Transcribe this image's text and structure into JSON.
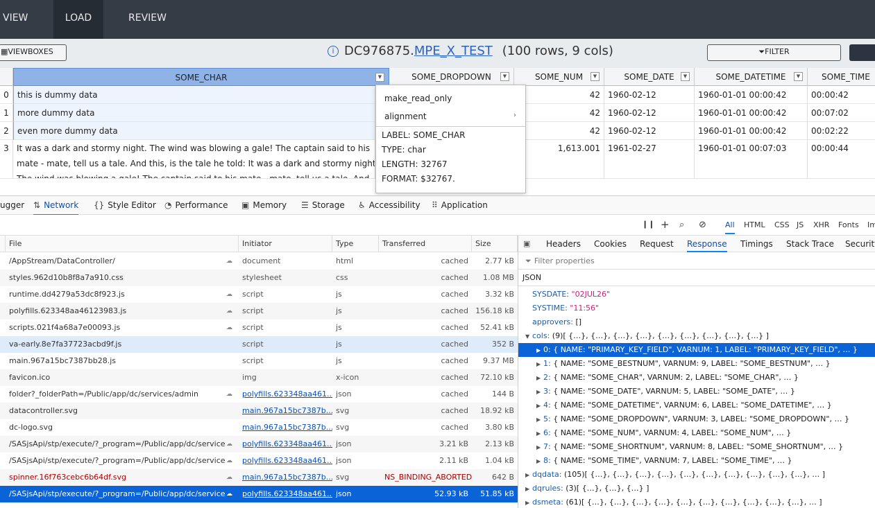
{
  "nav": {
    "tabs": [
      "VIEW",
      "LOAD",
      "REVIEW"
    ]
  },
  "titlebar": {
    "viewboxes_label": "VIEWBOXES",
    "library": "DC976875.",
    "table": "MPE_X_TEST",
    "meta": "(100 rows, 9 cols)",
    "filter_label": "FILTER"
  },
  "grid": {
    "columns": [
      "SOME_CHAR",
      "SOME_DROPDOWN",
      "SOME_NUM",
      "SOME_DATE",
      "SOME_DATETIME",
      "SOME_TIME"
    ],
    "rows": [
      {
        "idx": "0",
        "char": "this is dummy data",
        "num": "42",
        "date": "1960-02-12",
        "datetime": "1960-01-01 00:00:42",
        "time": "00:00:42"
      },
      {
        "idx": "1",
        "char": "more dummy data",
        "num": "42",
        "date": "1960-02-12",
        "datetime": "1960-01-01 00:00:42",
        "time": "00:07:02"
      },
      {
        "idx": "2",
        "char": "even more dummy data",
        "num": "42",
        "date": "1960-02-12",
        "datetime": "1960-01-01 00:00:42",
        "time": "00:02:22"
      },
      {
        "idx": "3",
        "char_lines": [
          "It was a dark and stormy night.  The wind was blowing a gale!  The captain said to his",
          "mate - mate, tell us a tale.  And this, is the tale he told: It was a dark and stormy night.",
          "The wind was blowing a gale!  The captain said to his mate - mate, tell us a tale.  And"
        ],
        "num": "1,613.001",
        "date": "1961-02-27",
        "datetime": "1960-01-01 00:07:03",
        "time": "00:00:44"
      }
    ]
  },
  "menu": {
    "items": [
      "make_read_only",
      "alignment"
    ],
    "info": [
      "LABEL: SOME_CHAR",
      "TYPE: char",
      "LENGTH: 32767",
      "FORMAT: $32767."
    ]
  },
  "devtools": {
    "tabs": [
      "ugger",
      "Network",
      "Style Editor",
      "Performance",
      "Memory",
      "Storage",
      "Accessibility",
      "Application"
    ],
    "filters": [
      "All",
      "HTML",
      "CSS",
      "JS",
      "XHR",
      "Fonts",
      "Im"
    ],
    "columns": [
      "File",
      "Initiator",
      "Type",
      "Transferred",
      "Size"
    ],
    "requests": [
      {
        "file": "/AppStream/DataController/",
        "initiator": "document",
        "type": "html",
        "transferred": "cached",
        "size": "2.77 kB"
      },
      {
        "file": "styles.962d10b8f8a7a910.css",
        "initiator": "stylesheet",
        "type": "css",
        "transferred": "cached",
        "size": "1.08 MB"
      },
      {
        "file": "runtime.dd4279a53dc8f923.js",
        "initiator": "script",
        "type": "js",
        "transferred": "cached",
        "size": "3.32 kB"
      },
      {
        "file": "polyfills.623348aa46123983.js",
        "initiator": "script",
        "type": "js",
        "transferred": "cached",
        "size": "156.18 kB"
      },
      {
        "file": "scripts.021f4a68a7e00093.js",
        "initiator": "script",
        "type": "js",
        "transferred": "cached",
        "size": "52.41 kB"
      },
      {
        "file": "va-early.8e7fa37723acbd9f.js",
        "initiator": "script",
        "type": "js",
        "transferred": "cached",
        "size": "352 B"
      },
      {
        "file": "main.967a15bc7387bb28.js",
        "initiator": "script",
        "type": "js",
        "transferred": "cached",
        "size": "9.37 MB"
      },
      {
        "file": "favicon.ico",
        "initiator": "img",
        "type": "x-icon",
        "transferred": "cached",
        "size": "72.10 kB"
      },
      {
        "file": "folder?_folderPath=/Public/app/dc/services/admin",
        "initiator": "polyfills.623348aa461...",
        "type": "json",
        "transferred": "cached",
        "size": "144 B"
      },
      {
        "file": "datacontroller.svg",
        "initiator": "main.967a15bc7387b...",
        "type": "svg",
        "transferred": "cached",
        "size": "18.92 kB"
      },
      {
        "file": "dc-logo.svg",
        "initiator": "main.967a15bc7387b...",
        "type": "svg",
        "transferred": "cached",
        "size": "3.80 kB"
      },
      {
        "file": "/SASjsApi/stp/execute/?_program=/Public/app/dc/services/p",
        "initiator": "polyfills.623348aa461...",
        "type": "json",
        "transferred": "3.21 kB",
        "size": "2.13 kB"
      },
      {
        "file": "/SASjsApi/stp/execute/?_program=/Public/app/dc/services/p",
        "initiator": "polyfills.623348aa461...",
        "type": "json",
        "transferred": "2.11 kB",
        "size": "1.04 kB"
      },
      {
        "file": "spinner.16f763cebc6b64df.svg",
        "initiator": "main.967a15bc7387b...",
        "type": "svg",
        "transferred": "NS_BINDING_ABORTED",
        "size": "642 B"
      },
      {
        "file": "/SASjsApi/stp/execute/?_program=/Public/app/dc/services/e",
        "initiator": "polyfills.623348aa461...",
        "type": "json",
        "transferred": "52.93 kB",
        "size": "51.85 kB"
      }
    ],
    "detail_tabs": [
      "Headers",
      "Cookies",
      "Request",
      "Response",
      "Timings",
      "Stack Trace",
      "Security"
    ],
    "filter_placeholder": "Filter properties",
    "json_label": "JSON",
    "json_lines": [
      {
        "key": "SYSDATE: ",
        "val": "\"02JUL26\"",
        "indent": 20,
        "tw": ""
      },
      {
        "key": "SYSTIME: ",
        "val": "\"11:56\"",
        "indent": 20,
        "tw": ""
      },
      {
        "key": "approvers: ",
        "val": "[]",
        "indent": 20,
        "tw": ""
      },
      {
        "key": "cols: ",
        "val": "(9)[ {…}, {…}, {…}, {…}, {…}, {…}, {…}, {…}, {…} ]",
        "indent": 10,
        "tw": "▼"
      },
      {
        "key": "0: ",
        "val": "{ NAME: \"PRIMARY_KEY_FIELD\", VARNUM: 1, LABEL: \"PRIMARY_KEY_FIELD\", … }",
        "indent": 26,
        "tw": "▶"
      },
      {
        "key": "1: ",
        "val": "{ NAME: \"SOME_BESTNUM\", VARNUM: 9, LABEL: \"SOME_BESTNUM\", … }",
        "indent": 26,
        "tw": "▶"
      },
      {
        "key": "2: ",
        "val": "{ NAME: \"SOME_CHAR\", VARNUM: 2, LABEL: \"SOME_CHAR\", … }",
        "indent": 26,
        "tw": "▶"
      },
      {
        "key": "3: ",
        "val": "{ NAME: \"SOME_DATE\", VARNUM: 5, LABEL: \"SOME_DATE\", … }",
        "indent": 26,
        "tw": "▶"
      },
      {
        "key": "4: ",
        "val": "{ NAME: \"SOME_DATETIME\", VARNUM: 6, LABEL: \"SOME_DATETIME\", … }",
        "indent": 26,
        "tw": "▶"
      },
      {
        "key": "5: ",
        "val": "{ NAME: \"SOME_DROPDOWN\", VARNUM: 3, LABEL: \"SOME_DROPDOWN\", … }",
        "indent": 26,
        "tw": "▶"
      },
      {
        "key": "6: ",
        "val": "{ NAME: \"SOME_NUM\", VARNUM: 4, LABEL: \"SOME_NUM\", … }",
        "indent": 26,
        "tw": "▶"
      },
      {
        "key": "7: ",
        "val": "{ NAME: \"SOME_SHORTNUM\", VARNUM: 8, LABEL: \"SOME_SHORTNUM\", … }",
        "indent": 26,
        "tw": "▶"
      },
      {
        "key": "8: ",
        "val": "{ NAME: \"SOME_TIME\", VARNUM: 7, LABEL: \"SOME_TIME\", … }",
        "indent": 26,
        "tw": "▶"
      },
      {
        "key": "dqdata: ",
        "val": "(105)[ {…}, {…}, {…}, {…}, {…}, {…}, {…}, {…}, {…}, {…}, … ]",
        "indent": 10,
        "tw": "▶"
      },
      {
        "key": "dqrules: ",
        "val": "(3)[ {…}, {…}, {…} ]",
        "indent": 10,
        "tw": "▶"
      },
      {
        "key": "dsmeta: ",
        "val": "(61)[ {…}, {…}, {…}, {…}, {…}, {…}, {…}, {…}, {…}, {…}, … ]",
        "indent": 10,
        "tw": "▶"
      }
    ]
  }
}
